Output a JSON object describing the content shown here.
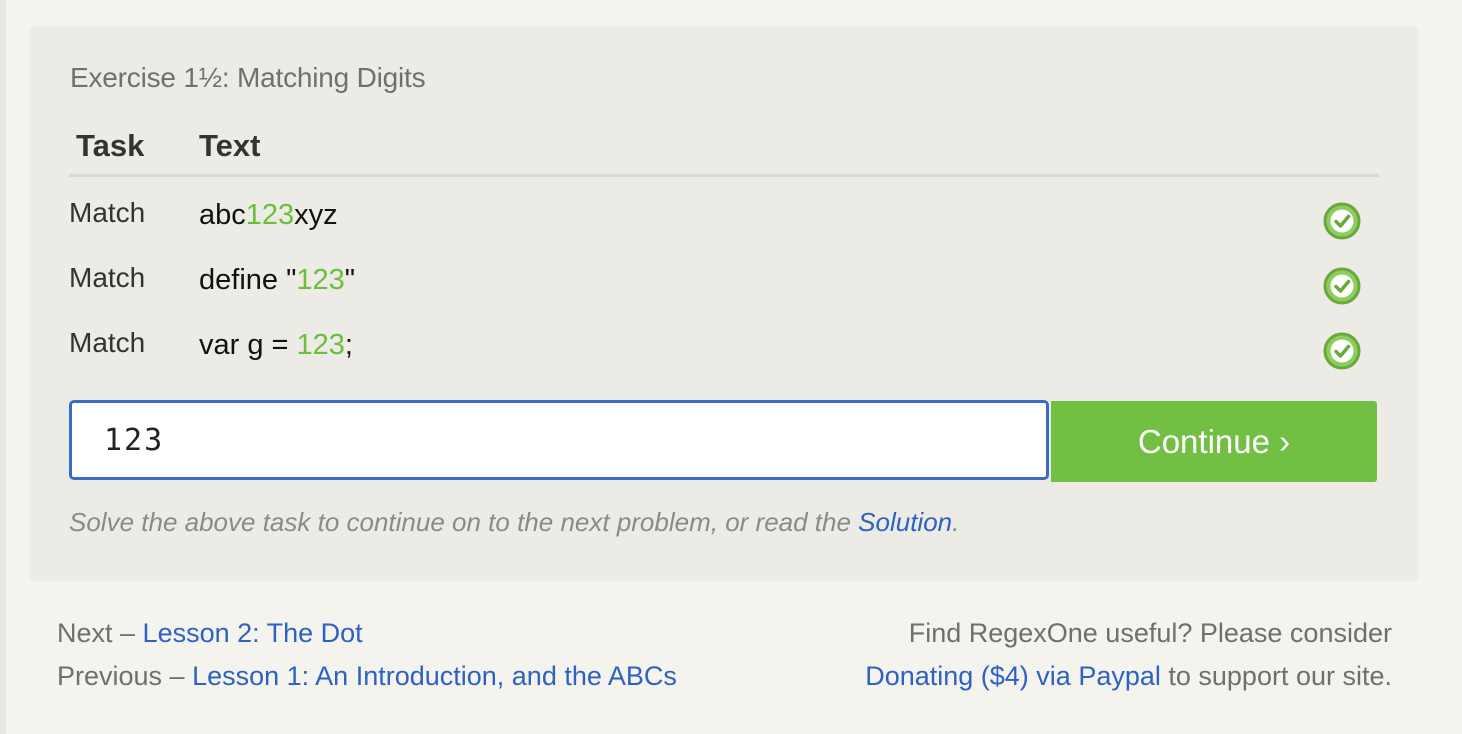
{
  "exercise": {
    "title": "Exercise 1½: Matching Digits",
    "headers": {
      "task": "Task",
      "text": "Text"
    },
    "rows": [
      {
        "task": "Match",
        "pre": "abc",
        "match": "123",
        "post": "xyz",
        "status": "check-icon"
      },
      {
        "task": "Match",
        "pre": "define \"",
        "match": "123",
        "post": "\"",
        "status": "check-icon"
      },
      {
        "task": "Match",
        "pre": "var g = ",
        "match": "123",
        "post": ";",
        "status": "check-icon"
      }
    ],
    "input_value": "123",
    "continue_label": "Continue ›",
    "hint_prefix": "Solve the above task to continue on to the next problem, or read the ",
    "hint_link": "Solution",
    "hint_suffix": "."
  },
  "footer": {
    "next_prefix": "Next – ",
    "next_link": "Lesson 2: The Dot",
    "previous_prefix": "Previous – ",
    "previous_link": "Lesson 1: An Introduction, and the ABCs",
    "donate_prefix": "Find RegexOne useful? Please consider",
    "donate_link": "Donating ($4) via Paypal",
    "donate_suffix": " to support our site."
  },
  "colors": {
    "accent_green": "#71c043",
    "match_green": "#6cbf3a",
    "link_blue": "#2d62c0",
    "input_border": "#3a6bc6"
  }
}
